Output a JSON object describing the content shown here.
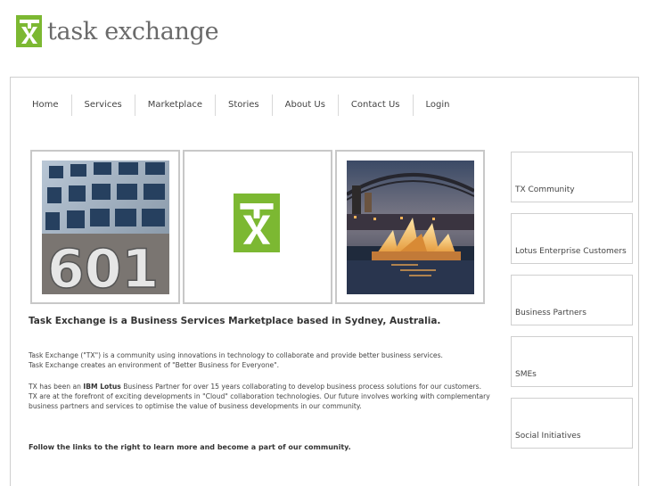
{
  "brand": {
    "name": "task exchange",
    "logo_color": "#7cb832"
  },
  "nav": {
    "items": [
      "Home",
      "Services",
      "Marketplace",
      "Stories",
      "About Us",
      "Contact Us",
      "Login"
    ]
  },
  "tiles": [
    {
      "image": "building-601-photo"
    },
    {
      "image": "tx-logo-icon"
    },
    {
      "image": "sydney-opera-house-photo"
    }
  ],
  "sidebar": {
    "items": [
      "TX Community",
      "Lotus Enterprise Customers",
      "Business Partners",
      "SMEs",
      "Social Initiatives"
    ]
  },
  "content": {
    "headline": "Task Exchange is a Business Services Marketplace based in Sydney, Australia.",
    "para1_line1": "Task Exchange (\"TX\") is a community using innovations in technology to collaborate and provide better business services.",
    "para1_line2": "Task Exchange creates an environment of \"Better Business for Everyone\".",
    "para2_prefix": "TX has been an ",
    "para2_bold": "IBM Lotus",
    "para2_rest": " Business Partner for over 15 years collaborating to develop business process solutions for our customers. TX are at the forefront of exciting developments in \"Cloud\" collaboration technologies. Our future involves working with complementary business partners and services to optimise the value of business developments in our community.",
    "follow": "Follow the links to the right to learn more and become a part of our community."
  }
}
